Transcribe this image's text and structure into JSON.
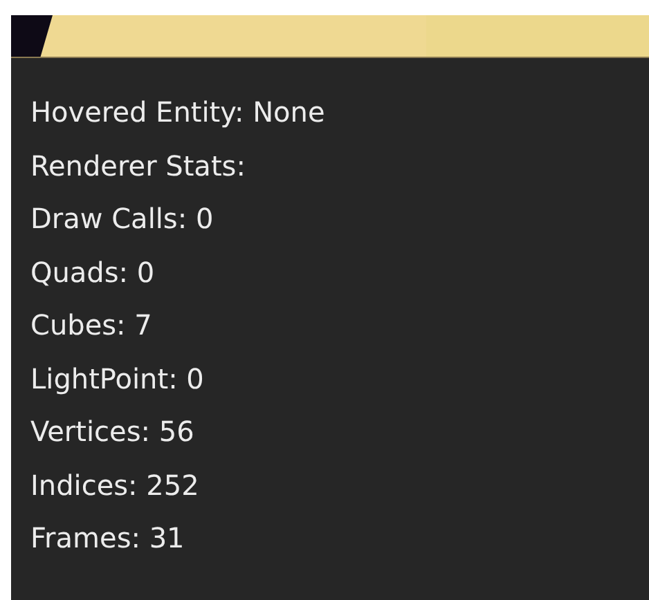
{
  "stats": [
    "Hovered Entity: None",
    "Renderer Stats:",
    "Draw Calls: 0",
    "Quads: 0",
    "Cubes: 7",
    "LightPoint: 0",
    "Vertices: 56",
    "Indices: 252",
    "Frames: 31"
  ]
}
